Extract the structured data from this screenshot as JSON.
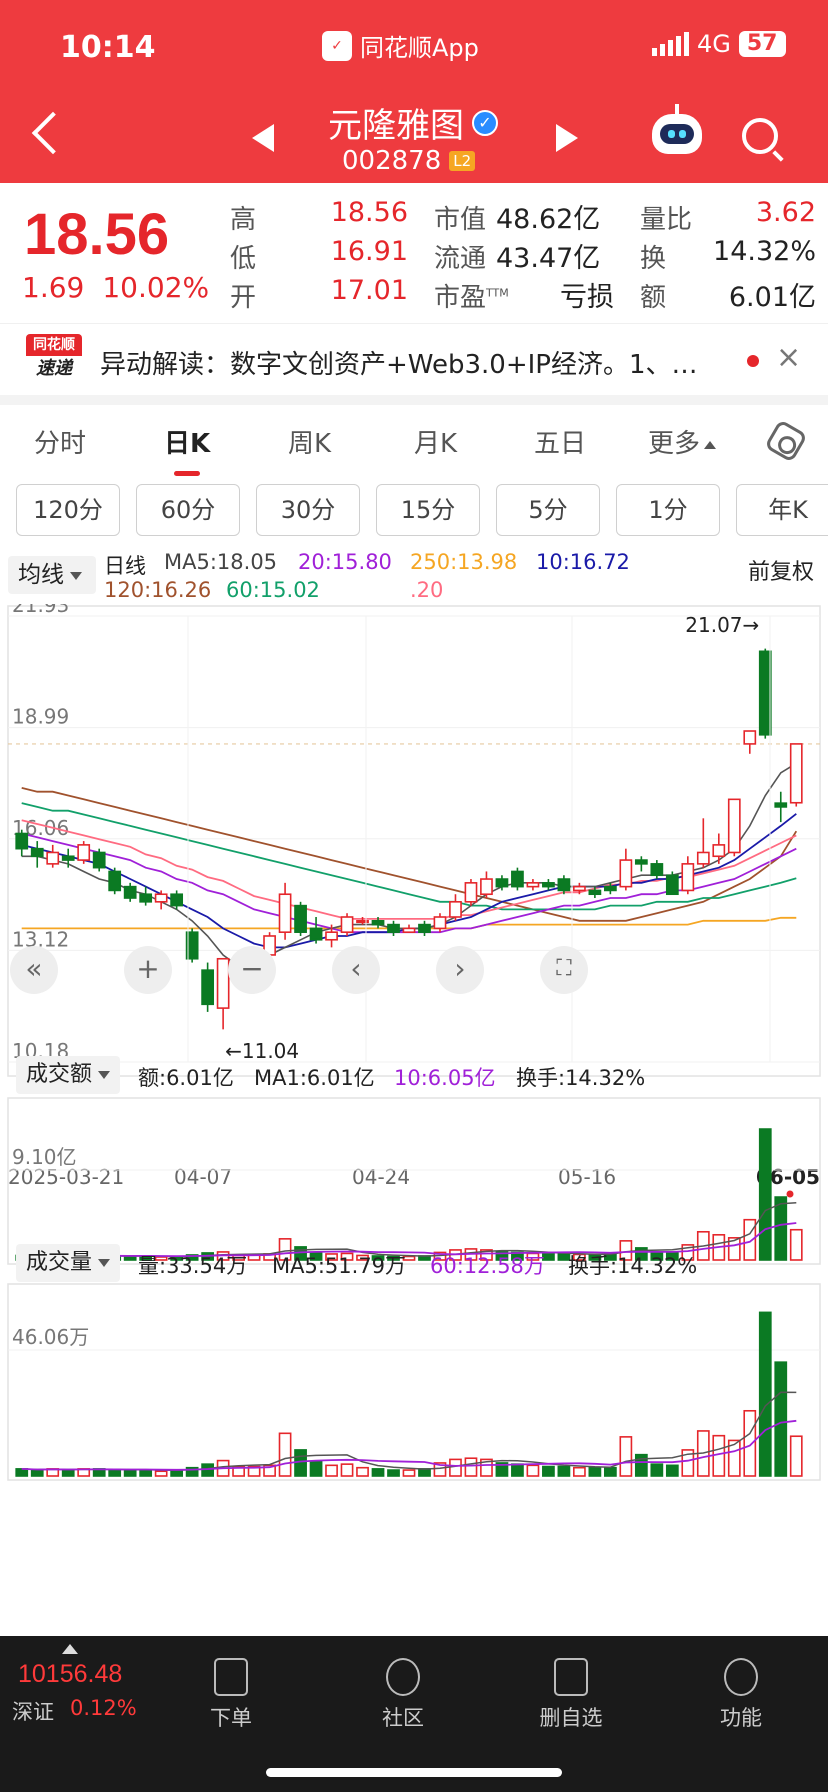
{
  "status": {
    "time": "10:14",
    "app": "同花顺App",
    "network": "4G",
    "battery": "57"
  },
  "stock": {
    "name": "元隆雅图",
    "code": "002878",
    "level": "L2"
  },
  "quote": {
    "price": "18.56",
    "change": "1.69",
    "change_pct": "10.02%",
    "rows": [
      {
        "l1": "高",
        "v1": "18.56",
        "l2": "市值",
        "v2": "48.62亿",
        "l3": "量比",
        "v3": "3.62"
      },
      {
        "l1": "低",
        "v1": "16.91",
        "l2": "流通",
        "v2": "43.47亿",
        "l3": "换",
        "v3": "14.32%"
      },
      {
        "l1": "开",
        "v1": "17.01",
        "l2": "市盈",
        "l2sup": "TTM",
        "v2": "亏损",
        "l3": "额",
        "v3": "6.01亿"
      }
    ]
  },
  "news": {
    "logo_top": "同花顺",
    "logo_bottom": "速递",
    "text": "异动解读：数字文创资产+Web3.0+IP经济。1、…",
    "close": "×"
  },
  "tabs": [
    "分时",
    "日K",
    "周K",
    "月K",
    "五日",
    "更多"
  ],
  "active_tab": "日K",
  "periods": [
    "120分",
    "60分",
    "30分",
    "15分",
    "5分",
    "1分",
    "年K"
  ],
  "ma_legend": {
    "selector": "均线",
    "period": "日线",
    "items_row1": [
      {
        "label": "MA5:18.05",
        "color": "#444444"
      },
      {
        "label": "20:15.80",
        "color": "#a020d8"
      },
      {
        "label": "250:13.98",
        "color": "#f5a623"
      },
      {
        "label": "10:16.72",
        "color": "#1a1aa8"
      }
    ],
    "items_row2": [
      {
        "label": "120:16.26",
        "color": "#a0522d"
      },
      {
        "label": "60:15.02",
        "color": "#12a06a"
      },
      {
        "label": ".20",
        "color": "#ff6b81"
      }
    ],
    "adjust": "前复权"
  },
  "chart_data": {
    "type": "candlestick",
    "y_ticks": [
      "21.93",
      "18.99",
      "16.06",
      "13.12",
      "10.18"
    ],
    "ylim": [
      10.18,
      21.93
    ],
    "x_labels": [
      "2025-03-21",
      "04-07",
      "04-24",
      "05-16",
      "06-05"
    ],
    "high_marker": "21.07→",
    "low_marker": "←11.04",
    "reference_price": 18.56,
    "candles": [
      [
        16.2,
        15.8,
        16.3,
        15.6
      ],
      [
        15.8,
        15.6,
        16.0,
        15.3
      ],
      [
        15.4,
        15.7,
        15.9,
        15.3
      ],
      [
        15.6,
        15.5,
        15.8,
        15.3
      ],
      [
        15.5,
        15.9,
        16.0,
        15.4
      ],
      [
        15.7,
        15.3,
        15.8,
        15.2
      ],
      [
        15.2,
        14.7,
        15.3,
        14.6
      ],
      [
        14.8,
        14.5,
        14.9,
        14.4
      ],
      [
        14.6,
        14.4,
        14.8,
        14.3
      ],
      [
        14.4,
        14.6,
        14.7,
        14.2
      ],
      [
        14.6,
        14.3,
        14.7,
        14.2
      ],
      [
        13.6,
        12.9,
        13.7,
        12.8
      ],
      [
        12.6,
        11.7,
        12.8,
        11.5
      ],
      [
        11.6,
        12.9,
        12.9,
        11.04
      ],
      [
        12.7,
        12.9,
        13.0,
        12.6
      ],
      [
        12.7,
        12.9,
        13.1,
        12.6
      ],
      [
        13.0,
        13.5,
        13.6,
        12.9
      ],
      [
        13.6,
        14.6,
        14.9,
        13.4
      ],
      [
        14.3,
        13.6,
        14.4,
        13.5
      ],
      [
        13.7,
        13.4,
        14.0,
        13.3
      ],
      [
        13.4,
        13.6,
        13.8,
        13.2
      ],
      [
        13.6,
        14.0,
        14.1,
        13.5
      ],
      [
        13.9,
        13.9,
        14.0,
        13.8
      ],
      [
        13.9,
        13.8,
        14.0,
        13.7
      ],
      [
        13.8,
        13.6,
        13.9,
        13.5
      ],
      [
        13.6,
        13.7,
        13.8,
        13.6
      ],
      [
        13.8,
        13.6,
        13.9,
        13.5
      ],
      [
        13.7,
        14.0,
        14.1,
        13.6
      ],
      [
        14.0,
        14.4,
        14.6,
        13.9
      ],
      [
        14.4,
        14.9,
        15.0,
        14.3
      ],
      [
        14.6,
        15.0,
        15.2,
        14.5
      ],
      [
        15.0,
        14.8,
        15.1,
        14.7
      ],
      [
        15.2,
        14.8,
        15.3,
        14.7
      ],
      [
        14.8,
        14.9,
        15.0,
        14.7
      ],
      [
        14.9,
        14.8,
        15.0,
        14.7
      ],
      [
        15.0,
        14.7,
        15.1,
        14.6
      ],
      [
        14.7,
        14.8,
        14.9,
        14.6
      ],
      [
        14.7,
        14.6,
        14.8,
        14.5
      ],
      [
        14.8,
        14.7,
        14.9,
        14.6
      ],
      [
        14.8,
        15.5,
        15.8,
        14.7
      ],
      [
        15.5,
        15.4,
        15.6,
        15.2
      ],
      [
        15.4,
        15.1,
        15.5,
        15.0
      ],
      [
        15.1,
        14.6,
        15.2,
        14.6
      ],
      [
        14.7,
        15.4,
        15.6,
        14.6
      ],
      [
        15.4,
        15.7,
        16.6,
        15.3
      ],
      [
        15.6,
        15.9,
        16.2,
        15.4
      ],
      [
        15.7,
        17.1,
        17.1,
        15.6
      ],
      [
        18.56,
        18.9,
        18.9,
        18.3
      ],
      [
        21.0,
        18.8,
        21.07,
        18.7
      ],
      [
        17.0,
        16.9,
        17.3,
        16.5
      ],
      [
        17.01,
        18.56,
        18.56,
        16.91
      ]
    ],
    "ma_lines": {
      "ma5": [
        15.6,
        15.6,
        15.5,
        15.4,
        15.2,
        15.0,
        14.9,
        14.7,
        14.6,
        14.4,
        14.2,
        13.9,
        13.5,
        13.0,
        12.7,
        12.8,
        13.0,
        13.2,
        13.4,
        13.6,
        13.7,
        13.8,
        13.8,
        13.8,
        13.7,
        13.7,
        13.7,
        13.8,
        14.0,
        14.3,
        14.6,
        14.8,
        14.9,
        14.9,
        14.9,
        14.8,
        14.8,
        14.8,
        14.9,
        15.0,
        15.1,
        15.1,
        15.1,
        15.2,
        15.3,
        15.5,
        15.8,
        16.4,
        17.2,
        17.8,
        18.05
      ],
      "ma10": [
        15.9,
        15.8,
        15.7,
        15.6,
        15.5,
        15.4,
        15.2,
        15.0,
        14.8,
        14.6,
        14.4,
        14.2,
        14.0,
        13.7,
        13.5,
        13.3,
        13.2,
        13.2,
        13.3,
        13.4,
        13.5,
        13.5,
        13.6,
        13.6,
        13.6,
        13.7,
        13.7,
        13.8,
        13.9,
        14.0,
        14.2,
        14.4,
        14.5,
        14.6,
        14.7,
        14.8,
        14.8,
        14.8,
        14.8,
        14.9,
        14.9,
        15.0,
        15.0,
        15.1,
        15.2,
        15.3,
        15.5,
        15.8,
        16.1,
        16.4,
        16.72
      ],
      "ma20": [
        16.2,
        16.1,
        16.0,
        15.9,
        15.8,
        15.7,
        15.6,
        15.5,
        15.3,
        15.2,
        15.0,
        14.9,
        14.7,
        14.6,
        14.4,
        14.2,
        14.1,
        14.0,
        13.9,
        13.8,
        13.7,
        13.6,
        13.6,
        13.6,
        13.6,
        13.6,
        13.6,
        13.6,
        13.7,
        13.7,
        13.8,
        13.9,
        14.0,
        14.1,
        14.2,
        14.3,
        14.3,
        14.4,
        14.5,
        14.5,
        14.6,
        14.6,
        14.7,
        14.7,
        14.8,
        14.9,
        15.0,
        15.2,
        15.4,
        15.6,
        15.8
      ],
      "ma60": [
        17.0,
        16.9,
        16.8,
        16.8,
        16.7,
        16.6,
        16.5,
        16.4,
        16.3,
        16.2,
        16.1,
        16.0,
        15.9,
        15.8,
        15.7,
        15.6,
        15.5,
        15.4,
        15.3,
        15.2,
        15.1,
        15.0,
        14.9,
        14.8,
        14.7,
        14.6,
        14.5,
        14.4,
        14.4,
        14.3,
        14.3,
        14.2,
        14.2,
        14.2,
        14.2,
        14.2,
        14.2,
        14.2,
        14.3,
        14.3,
        14.3,
        14.4,
        14.4,
        14.4,
        14.5,
        14.5,
        14.6,
        14.7,
        14.8,
        14.9,
        15.02
      ],
      "ma120": [
        17.4,
        17.3,
        17.3,
        17.2,
        17.1,
        17.0,
        16.9,
        16.8,
        16.7,
        16.6,
        16.5,
        16.4,
        16.3,
        16.2,
        16.1,
        16.0,
        15.9,
        15.8,
        15.7,
        15.6,
        15.5,
        15.4,
        15.3,
        15.2,
        15.1,
        15.0,
        14.9,
        14.8,
        14.7,
        14.6,
        14.5,
        14.4,
        14.3,
        14.2,
        14.1,
        14.0,
        13.9,
        13.9,
        13.9,
        13.9,
        14.0,
        14.1,
        14.2,
        14.3,
        14.4,
        14.6,
        14.8,
        15.0,
        15.3,
        15.6,
        16.26
      ],
      "ma250": [
        15.8,
        15.8,
        15.8,
        15.8,
        15.8,
        15.8,
        15.8,
        15.9,
        15.9,
        15.9,
        15.9,
        15.9,
        15.9,
        15.9,
        15.9,
        15.9,
        16.0,
        16.0,
        16.0,
        16.0,
        16.0,
        16.0,
        16.0,
        16.0,
        16.0,
        16.0,
        16.0,
        16.0,
        16.0,
        16.0,
        16.0,
        16.0,
        16.0,
        16.0,
        16.0,
        16.0,
        16.0,
        16.0,
        16.0,
        16.0,
        16.0,
        16.0,
        16.0,
        16.0,
        16.0,
        16.0,
        16.1,
        16.1,
        16.1,
        16.2,
        16.2
      ],
      "ma_orange": [
        13.7,
        13.7,
        13.7,
        13.7,
        13.7,
        13.7,
        13.7,
        13.7,
        13.7,
        13.7,
        13.7,
        13.7,
        13.7,
        13.7,
        13.7,
        13.7,
        13.7,
        13.7,
        13.7,
        13.7,
        13.7,
        13.7,
        13.7,
        13.7,
        13.7,
        13.7,
        13.7,
        13.7,
        13.7,
        13.7,
        13.8,
        13.8,
        13.8,
        13.8,
        13.8,
        13.8,
        13.8,
        13.8,
        13.8,
        13.8,
        13.8,
        13.8,
        13.8,
        13.8,
        13.9,
        13.9,
        13.9,
        13.9,
        13.9,
        13.98,
        13.98
      ]
    },
    "amount": {
      "label": "成交额",
      "items": [
        {
          "label": "额:6.01亿",
          "color": "#333333"
        },
        {
          "label": "MA1:6.01亿",
          "color": "#333333"
        },
        {
          "label": "10:6.05亿",
          "color": "#a020d8"
        },
        {
          "label": "换手:14.32%",
          "color": "#333333"
        }
      ],
      "y_tick": "9.10亿",
      "ymax": 27,
      "values": [
        0.9,
        0.8,
        0.9,
        0.7,
        0.8,
        0.9,
        0.8,
        0.7,
        0.8,
        0.6,
        0.7,
        1.0,
        1.4,
        1.6,
        0.9,
        1.0,
        1.2,
        4.2,
        2.6,
        1.5,
        1.2,
        1.3,
        0.9,
        0.8,
        0.7,
        0.7,
        0.8,
        1.5,
        2.0,
        2.2,
        2.0,
        1.6,
        1.5,
        1.3,
        1.2,
        1.2,
        1.1,
        1.0,
        1.1,
        3.8,
        2.4,
        1.5,
        1.4,
        3.0,
        5.6,
        5.0,
        4.4,
        8.0,
        26.0,
        12.5,
        6.01
      ]
    },
    "volume": {
      "label": "成交量",
      "items": [
        {
          "label": "量:33.54万",
          "color": "#333333"
        },
        {
          "label": "MA5:51.79万",
          "color": "#333333"
        },
        {
          "label": "60:12.58万",
          "color": "#a020d8"
        },
        {
          "label": "换手:14.32%",
          "color": "#333333"
        }
      ],
      "y_tick": "46.06万",
      "ymax": 140,
      "values": [
        6,
        5,
        6,
        5,
        6,
        6,
        5,
        5,
        5,
        4,
        5,
        7,
        10,
        13,
        8,
        8,
        9,
        36,
        22,
        12,
        9,
        10,
        7,
        6,
        5,
        5,
        6,
        11,
        14,
        15,
        14,
        11,
        10,
        9,
        8,
        8,
        7,
        7,
        7,
        33,
        18,
        10,
        9,
        22,
        38,
        34,
        30,
        55,
        138,
        96,
        33.54
      ]
    }
  },
  "bottom_bar": {
    "index_value": "10156.48",
    "index_name": "深证",
    "index_pct": "0.12%",
    "items": [
      "下单",
      "社区",
      "删自选",
      "功能"
    ]
  },
  "colors": {
    "up": "#e5262b",
    "down": "#0b7a23",
    "header": "#ee3b3f"
  }
}
